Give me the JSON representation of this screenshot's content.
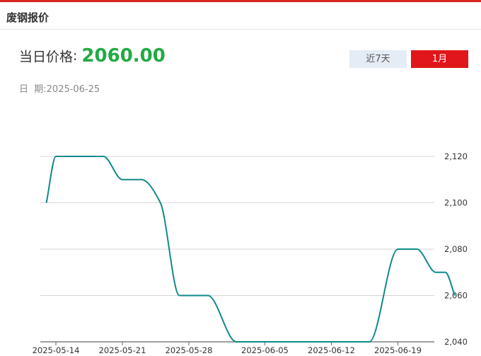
{
  "header": {
    "title": "废钢报价"
  },
  "price": {
    "label": "当日价格",
    "colon": ":",
    "value": "2060.00"
  },
  "date": {
    "label": "日  期:",
    "value": "2025-06-25"
  },
  "range_buttons": {
    "week": "近7天",
    "month": "1月",
    "active": "1月"
  },
  "colors": {
    "accent": "#e0161b",
    "price_green": "#22aa44",
    "line": "#0f8a8a",
    "week_button_bg": "#e4ecf5"
  },
  "chart_data": {
    "type": "line",
    "x_ticks": [
      "2025-05-14",
      "2025-05-21",
      "2025-05-28",
      "2025-06-05",
      "2025-06-12",
      "2025-06-19"
    ],
    "y_ticks": [
      2040,
      2060,
      2080,
      2100,
      2120
    ],
    "y_tick_labels": [
      "2,040",
      "2,060",
      "2,080",
      "2,100",
      "2,120"
    ],
    "ylim": [
      2040,
      2120
    ],
    "y_axis_side": "right",
    "grid": true,
    "points": [
      {
        "x": "2025-05-13",
        "y": 2100
      },
      {
        "x": "2025-05-14",
        "y": 2120
      },
      {
        "x": "2025-05-19",
        "y": 2120
      },
      {
        "x": "2025-05-21",
        "y": 2110
      },
      {
        "x": "2025-05-23",
        "y": 2110
      },
      {
        "x": "2025-05-25",
        "y": 2100
      },
      {
        "x": "2025-05-27",
        "y": 2060
      },
      {
        "x": "2025-05-28",
        "y": 2060
      },
      {
        "x": "2025-05-30",
        "y": 2060
      },
      {
        "x": "2025-06-02",
        "y": 2040
      },
      {
        "x": "2025-06-04",
        "y": 2040
      },
      {
        "x": "2025-06-16",
        "y": 2040
      },
      {
        "x": "2025-06-19",
        "y": 2080
      },
      {
        "x": "2025-06-21",
        "y": 2080
      },
      {
        "x": "2025-06-23",
        "y": 2070
      },
      {
        "x": "2025-06-24",
        "y": 2070
      },
      {
        "x": "2025-06-25",
        "y": 2060
      }
    ]
  }
}
